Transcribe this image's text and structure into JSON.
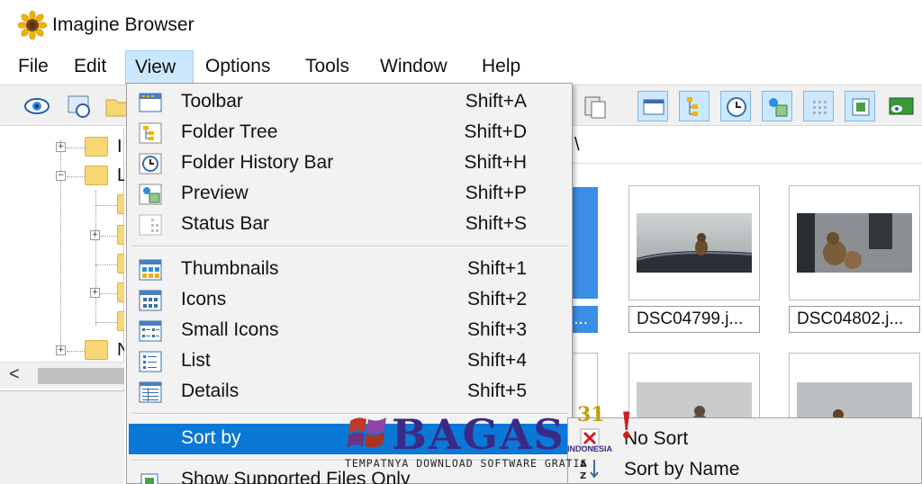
{
  "window": {
    "title": "Imagine Browser"
  },
  "menubar": {
    "items": [
      {
        "label": "File"
      },
      {
        "label": "Edit"
      },
      {
        "label": "View"
      },
      {
        "label": "Options"
      },
      {
        "label": "Tools"
      },
      {
        "label": "Window"
      },
      {
        "label": "Help"
      }
    ],
    "active": "View"
  },
  "view_menu": {
    "groups": [
      [
        {
          "label": "Toolbar",
          "shortcut": "Shift+A",
          "icon": "toolbar-icon"
        },
        {
          "label": "Folder Tree",
          "shortcut": "Shift+D",
          "icon": "folder-tree-icon"
        },
        {
          "label": "Folder History Bar",
          "shortcut": "Shift+H",
          "icon": "history-icon"
        },
        {
          "label": "Preview",
          "shortcut": "Shift+P",
          "icon": "preview-icon"
        },
        {
          "label": "Status Bar",
          "shortcut": "Shift+S",
          "icon": "status-bar-icon"
        }
      ],
      [
        {
          "label": "Thumbnails",
          "shortcut": "Shift+1",
          "icon": "thumbnails-icon"
        },
        {
          "label": "Icons",
          "shortcut": "Shift+2",
          "icon": "icons-view-icon"
        },
        {
          "label": "Small Icons",
          "shortcut": "Shift+3",
          "icon": "small-icons-icon"
        },
        {
          "label": "List",
          "shortcut": "Shift+4",
          "icon": "list-view-icon"
        },
        {
          "label": "Details",
          "shortcut": "Shift+5",
          "icon": "details-view-icon"
        }
      ]
    ],
    "sort_by": {
      "label": "Sort by",
      "highlighted": true
    },
    "show_supported": {
      "label": "Show Supported Files Only"
    }
  },
  "sort_submenu": {
    "items": [
      {
        "label": "No Sort",
        "icon": "no-sort-icon"
      },
      {
        "label": "Sort by Name",
        "icon": "sort-by-name-icon"
      }
    ]
  },
  "address": {
    "text": "\\"
  },
  "thumbnails": [
    {
      "caption": "DSC04799.j..."
    },
    {
      "caption": "DSC04802.j..."
    }
  ],
  "selected_caption_fragment": "i...",
  "tree": {
    "scroll_left": "<",
    "partial_labels": [
      "I",
      "L",
      "N"
    ]
  },
  "watermark": {
    "brand": "BAGAS",
    "number": "31",
    "region": "INDONESIA",
    "tagline": "TEMPATNYA DOWNLOAD SOFTWARE GRATIS"
  },
  "colors": {
    "highlight": "#0a78d7",
    "menu_bg": "#f2f2f2",
    "active_menu": "#cce8ff",
    "selected_thumb": "#3a8ee6"
  }
}
